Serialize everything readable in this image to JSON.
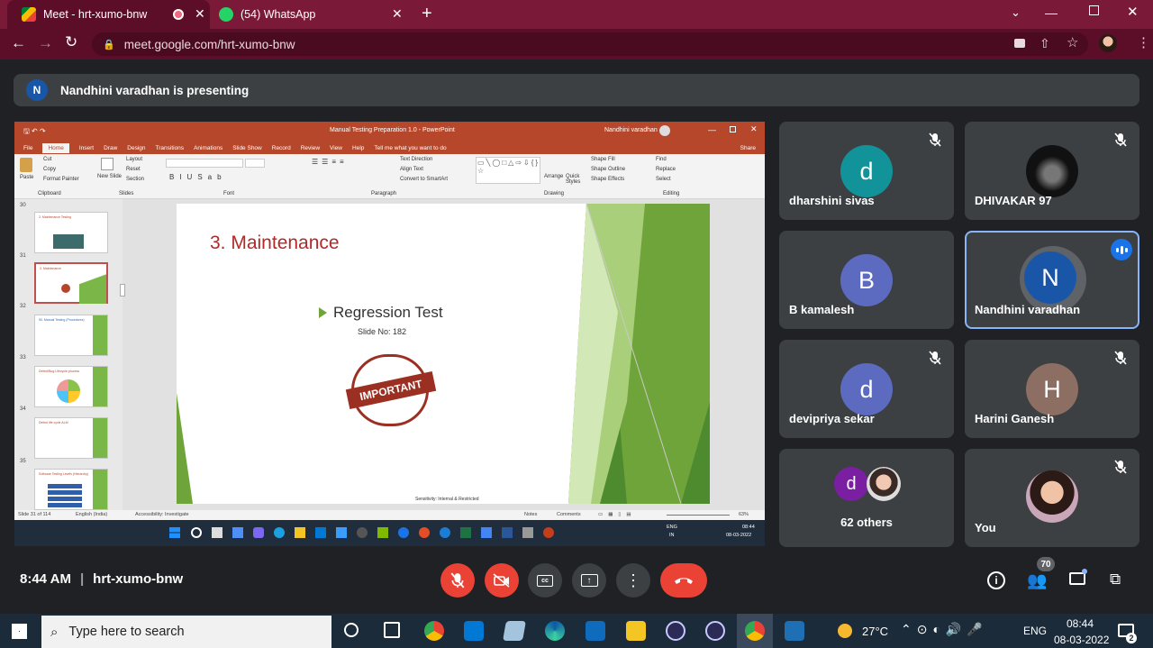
{
  "browser": {
    "tabs": [
      {
        "title": "Meet - hrt-xumo-bnw"
      },
      {
        "title": "(54) WhatsApp",
        "badge": "54"
      }
    ],
    "url": "meet.google.com/hrt-xumo-bnw"
  },
  "presenting": {
    "avatar": "N",
    "text": "Nandhini varadhan is presenting"
  },
  "powerpoint": {
    "title": "Manual Testing Preparation 1.0  -  PowerPoint",
    "user": "Nandhini varadhan",
    "menu": [
      "File",
      "Home",
      "Insert",
      "Draw",
      "Design",
      "Transitions",
      "Animations",
      "Slide Show",
      "Record",
      "Review",
      "View",
      "Help"
    ],
    "tell_me": "Tell me what you want to do",
    "share": "Share",
    "ribbon": {
      "clipboard": [
        "Cut",
        "Copy",
        "Format Painter"
      ],
      "paste": "Paste",
      "new_slide": "New Slide",
      "slides_opts": [
        "Layout",
        "Reset",
        "Section"
      ],
      "groups": [
        "Clipboard",
        "Slides",
        "Font",
        "Paragraph",
        "Drawing",
        "Editing"
      ],
      "paragraph_opts": [
        "Text Direction",
        "Align Text",
        "Convert to SmartArt"
      ],
      "arrange": "Arrange",
      "quick_styles": "Quick Styles",
      "shape_opts": [
        "Shape Fill",
        "Shape Outline",
        "Shape Effects"
      ],
      "editing_opts": [
        "Find",
        "Replace",
        "Select"
      ]
    },
    "thumbnails": [
      {
        "num": "30",
        "title": "2. Maintenance Testing"
      },
      {
        "num": "31",
        "title": "3. Maintenance"
      },
      {
        "num": "32",
        "title": "50. Manual Testing (Procedures)"
      },
      {
        "num": "33",
        "title": "Defect/Bug Lifecycle process"
      },
      {
        "num": "34",
        "title": "Defect life cycle ALM"
      },
      {
        "num": "35",
        "title": "Software Testing Levels (Hierarchy)"
      }
    ],
    "slide": {
      "title": "3. Maintenance",
      "bullet": "Regression Test",
      "sub": "Slide No: 182",
      "stamp": "IMPORTANT",
      "footer": "Sensitivity: Internal & Restricted"
    },
    "status": {
      "slide": "Slide 31 of 114",
      "lang": "English (India)",
      "accessibility": "Accessibility: Investigate",
      "notes": "Notes",
      "comments": "Comments",
      "zoom": "63%"
    },
    "taskbar": {
      "lang": "ENG",
      "region": "IN",
      "time": "08:44",
      "date": "08-03-2022"
    }
  },
  "participants": [
    {
      "name": "dharshini sivas",
      "initial": "d",
      "color": "#12939a",
      "muted": true
    },
    {
      "name": "DHIVAKAR 97",
      "photo": true,
      "muted": true
    },
    {
      "name": "B kamalesh",
      "initial": "B",
      "color": "#5c6bc0",
      "muted": false
    },
    {
      "name": "Nandhini varadhan",
      "initial": "N",
      "color": "#1a56a8",
      "speaking": true
    },
    {
      "name": "devipriya sekar",
      "initial": "d",
      "color": "#5c6bc0",
      "muted": true
    },
    {
      "name": "Harini Ganesh",
      "initial": "H",
      "color": "#8d6e63",
      "muted": true
    },
    {
      "name": "62 others",
      "initial": "d",
      "color": "#7b1fa2"
    },
    {
      "name": "You",
      "muted": true
    }
  ],
  "meeting": {
    "time": "8:44 AM",
    "separator": "|",
    "code": "hrt-xumo-bnw",
    "people_count": "70"
  },
  "taskbar": {
    "search_placeholder": "Type here to search",
    "temp": "27°C",
    "lang": "ENG",
    "time": "08:44",
    "date": "08-03-2022",
    "notif": "2"
  }
}
